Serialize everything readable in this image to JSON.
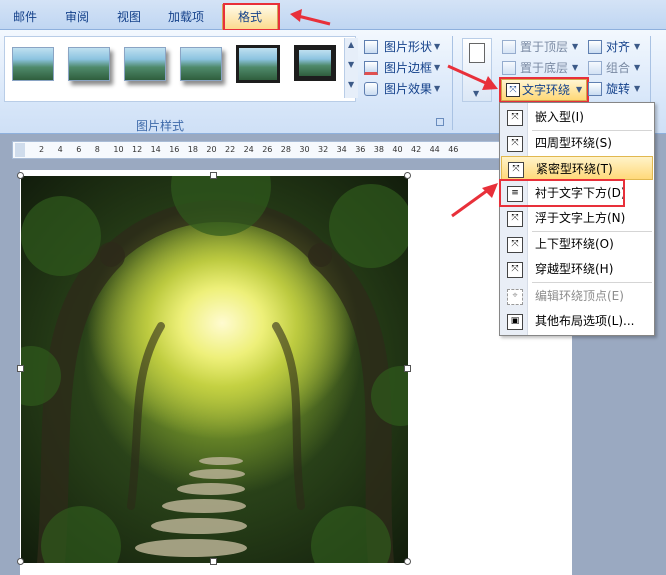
{
  "tabs": {
    "mail": "邮件",
    "review": "审阅",
    "view": "视图",
    "addins": "加载项",
    "format": "格式"
  },
  "ribbon": {
    "picture_styles": {
      "group_label": "图片样式",
      "picture_shape": "图片形状",
      "picture_border": "图片边框",
      "picture_effects": "图片效果"
    },
    "arrange": {
      "bring_to_front": "置于顶层",
      "send_to_back": "置于底层",
      "text_wrapping": "文字环绕",
      "align": "对齐",
      "group": "组合",
      "rotate": "旋转"
    }
  },
  "wrap_menu": {
    "items": [
      {
        "label": "嵌入型(I)",
        "state": "normal"
      },
      {
        "label": "四周型环绕(S)",
        "state": "normal"
      },
      {
        "label": "紧密型环绕(T)",
        "state": "highlighted"
      },
      {
        "label": "衬于文字下方(D)",
        "state": "boxed"
      },
      {
        "label": "浮于文字上方(N)",
        "state": "normal"
      },
      {
        "label": "上下型环绕(O)",
        "state": "normal"
      },
      {
        "label": "穿越型环绕(H)",
        "state": "normal"
      },
      {
        "label": "编辑环绕顶点(E)",
        "state": "disabled"
      },
      {
        "label": "其他布局选项(L)...",
        "state": "normal"
      }
    ]
  },
  "ruler": {
    "ticks": [
      "2",
      "4",
      "6",
      "8",
      "10",
      "12",
      "14",
      "16",
      "18",
      "20",
      "22",
      "24",
      "26",
      "28",
      "30",
      "32",
      "34",
      "36",
      "38",
      "40",
      "42",
      "44",
      "46"
    ]
  },
  "colors": {
    "highlight_box": "#e8303a",
    "ribbon_bg": "#d7e6f9",
    "menu_highlight": "#ffd97a"
  }
}
